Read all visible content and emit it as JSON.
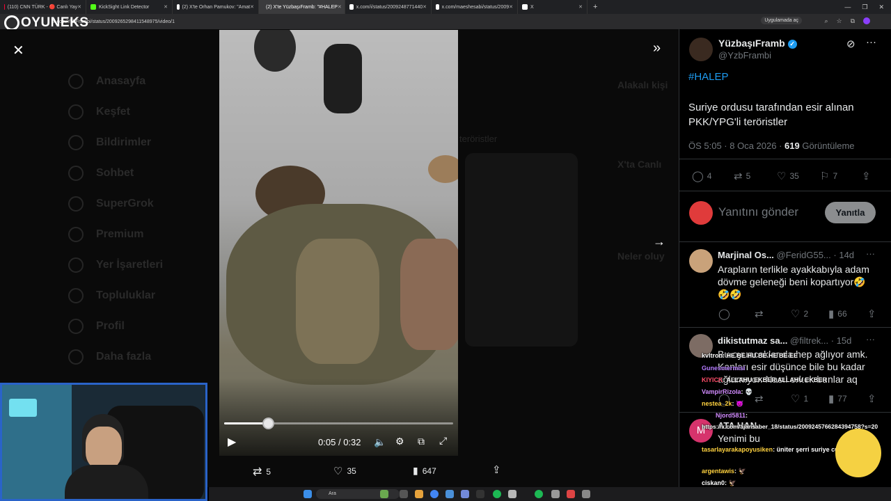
{
  "browser": {
    "tabs": [
      {
        "title": "(110) CNN TÜRK - 🔴 Canlı Yay",
        "color": "#ff0033"
      },
      {
        "title": "KickSight Link Detector",
        "color": "#53fc18"
      },
      {
        "title": "(2) X'te Orhan Pamukov: \"Amat",
        "color": "#ffffff"
      },
      {
        "title": "(2) X'te YüzbaşıFramb: \"#HALEP",
        "color": "#ffffff"
      },
      {
        "title": "x.com/i/status/2009248771440",
        "color": "#ffffff"
      },
      {
        "title": "x.com/maeshesabi/status/2009",
        "color": "#ffffff"
      },
      {
        "title": "X",
        "color": "#ffffff"
      }
    ],
    "url": "x.com/YzbFrambi/status/2009265298411548975/video/1",
    "translate_label": "Uygulamada aç"
  },
  "overlay_logo": "OYUNEKS",
  "background_nav": [
    "Anasayfa",
    "Keşfet",
    "Bildirimler",
    "Sohbet",
    "SuperGrok",
    "Premium",
    "Yer İşaretleri",
    "Topluluklar",
    "Profil",
    "Daha fazla"
  ],
  "background_ghost": {
    "related": "Alakalı kişi",
    "live": "X'ta Canlı",
    "trending": "Neler oluy",
    "terrorists": "teröristler"
  },
  "video": {
    "time_current": "0:05",
    "time_total": "0:32",
    "time_separator": "/",
    "progress": 0.19
  },
  "video_stats": {
    "reposts": "5",
    "likes": "35",
    "views": "647"
  },
  "tweet": {
    "author_name": "YüzbaşıFramb",
    "author_handle": "@YzbFrambi",
    "hashtag": "#HALEP",
    "text": "Suriye ordusu tarafından esir alınan PKK/YPG'li teröristler",
    "meta_time": "ÖS 5:05 · 8 Oca 2026 ·",
    "views_count": "619",
    "views_label": "Görüntüleme",
    "replies": "4",
    "reposts": "5",
    "likes": "35",
    "bookmarks": "7"
  },
  "reply_box": {
    "placeholder": "Yanıtını gönder",
    "button": "Yanıtla"
  },
  "replies": [
    {
      "name": "Marjinal Os...",
      "handle": "@FeridG55...",
      "time": "· 14d",
      "text": "Arapların terlikle ayakkabıyla adam dövme geleneği beni kopartıyor🤣🤣🤣",
      "likes": "2",
      "views": "66"
    },
    {
      "name": "dikistutmaz sa...",
      "handle": "@filtrek...",
      "time": "· 15d",
      "text": "Bu oyuncaklar da hep ağlıyor amk. Kanları esir düşünce bile bu kadar ağlamıyor. Nasıl erkek bunlar aq",
      "likes": "1",
      "views": "77"
    },
    {
      "name": "ATA HAN",
      "text": "Yenimi bu"
    }
  ],
  "chat": [
    {
      "user": "kvltron",
      "msg": ": HE BE HU BE HE BE EE",
      "color": "#ffffff"
    },
    {
      "user": "Gunesmermisi",
      "msg": "",
      "color": "#b57bff"
    },
    {
      "user": "KIYICK",
      "msg": ": ALLAHU EKBER ALLAHU EKBER",
      "color": "#ff4d6a"
    },
    {
      "user": "VampirRizola",
      "msg": ": 💀",
      "color": "#d28cff"
    },
    {
      "user": "nestea_2k",
      "msg": ": 😈",
      "color": "#ffd23f"
    },
    {
      "user": "Njord5811",
      "msg": ":",
      "color": "#d28cff"
    },
    {
      "user": "",
      "msg": "https://x.com/ajansaber_18/status/2009245766284394758?s=20",
      "color": "#ffffff"
    },
    {
      "user": "tasarlayarakapoyusiken",
      "msg": ": üniter şerri suriye cumhuriyeti için",
      "color": "#ffd23f"
    },
    {
      "user": "argentawis",
      "msg": ": 🦅",
      "color": "#ffd23f"
    },
    {
      "user": "ciskan0",
      "msg": ": 🦅",
      "color": "#ffffff"
    }
  ],
  "taskbar": {
    "search": "Ara"
  }
}
